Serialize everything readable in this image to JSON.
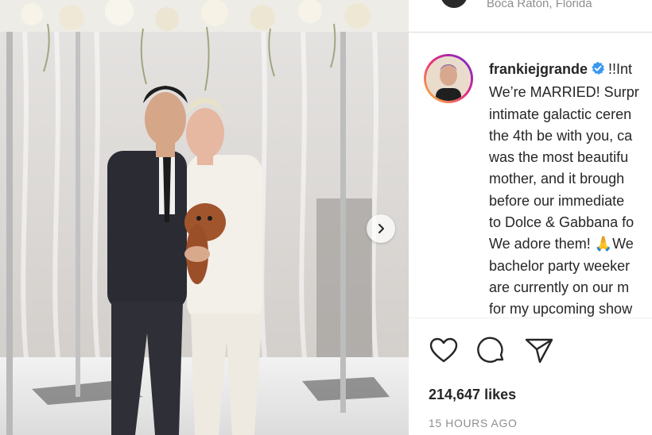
{
  "location": {
    "text": "Boca Raton, Florida"
  },
  "caption": {
    "username": "frankiejgrande",
    "lines": [
      "!!Int",
      "We’re MARRIED! Surpr",
      "intimate galactic ceren",
      "the 4th be with you, ca",
      "was the most beautifu",
      "mother, and it brough",
      "before our immediate",
      "to Dolce & Gabbana fo",
      "We adore them! 🙏We",
      "bachelor party weeker",
      "are currently on our m",
      "for my upcoming show"
    ]
  },
  "actions": {
    "like_icon": "heart-icon",
    "comment_icon": "comment-icon",
    "share_icon": "share-icon"
  },
  "likes": "214,647 likes",
  "timestamp": "15 HOURS AGO",
  "photo": {
    "next_icon": "chevron-right-icon"
  },
  "colors": {
    "verified": "#3897f0",
    "muted": "#8e8e8e",
    "text": "#262626"
  }
}
